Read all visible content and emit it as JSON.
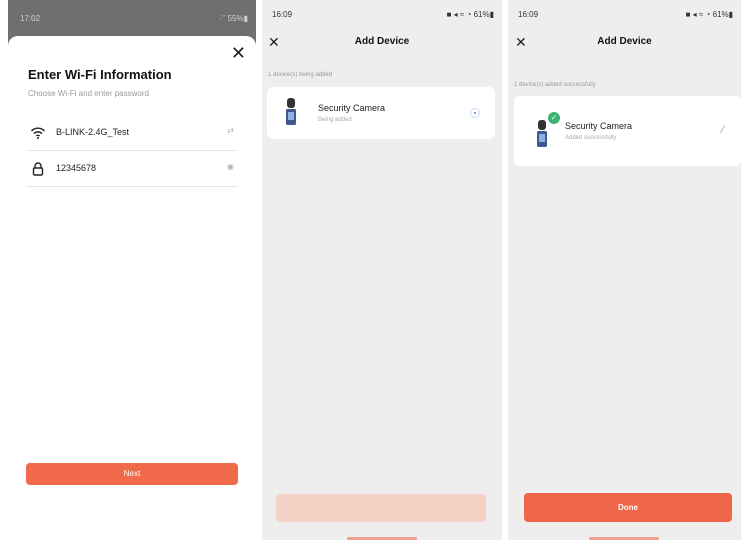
{
  "screen_wifi": {
    "status": {
      "time": "17:02",
      "icons": "·‵‵ 55%▮"
    },
    "close_label": "✕",
    "title": "Enter Wi-Fi Information",
    "subtitle": "Choose Wi-Fi and enter password",
    "wifi_name": "B-LINK-2.4G_Test",
    "wifi_switch_icon": "⇄",
    "password": "12345678",
    "eye_icon": "◉",
    "next_label": "Next"
  },
  "screen_adding": {
    "status": {
      "time": "16:09",
      "icons": "■ ◂ ≈ ◔ 61%▮"
    },
    "close_label": "✕",
    "title": "Add Device",
    "section_label": "1 device(s) being added",
    "device": {
      "name": "Security Camera",
      "status": "Being added"
    },
    "button_label": ""
  },
  "screen_added": {
    "status": {
      "time": "16:09",
      "icons": "■ ◂ ≈ ◔ 61%▮"
    },
    "close_label": "✕",
    "title": "Add Device",
    "section_label": "1 device(s) added successfully",
    "device": {
      "name": "Security Camera",
      "status": "Added successfully"
    },
    "check_glyph": "✓",
    "edit_glyph": "∕",
    "done_label": "Done"
  },
  "colors": {
    "accent": "#ee6548",
    "accent_disabled": "#f6d1c6",
    "success": "#3cb371"
  }
}
